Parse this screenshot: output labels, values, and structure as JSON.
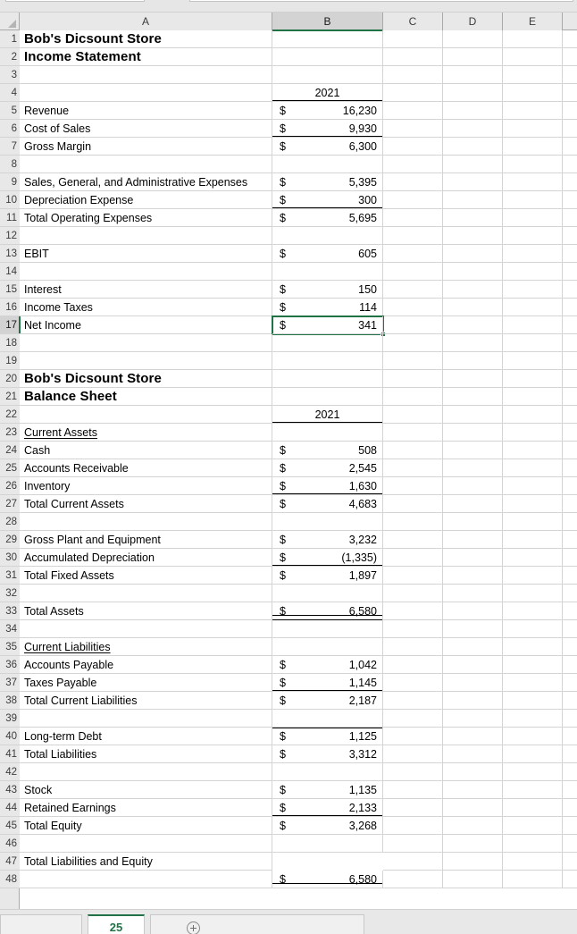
{
  "app": {
    "name": "spreadsheet",
    "selected_cell": "B17"
  },
  "columns": [
    {
      "id": "A",
      "label": "A",
      "selected": false
    },
    {
      "id": "B",
      "label": "B",
      "selected": true
    },
    {
      "id": "C",
      "label": "C",
      "selected": false
    },
    {
      "id": "D",
      "label": "D",
      "selected": false
    },
    {
      "id": "E",
      "label": "E",
      "selected": false
    }
  ],
  "row_numbers": [
    "1",
    "2",
    "3",
    "4",
    "5",
    "6",
    "7",
    "8",
    "9",
    "10",
    "11",
    "12",
    "13",
    "14",
    "15",
    "16",
    "17",
    "18",
    "19",
    "20",
    "21",
    "22",
    "23",
    "24",
    "25",
    "26",
    "27",
    "28",
    "29",
    "30",
    "31",
    "32",
    "33",
    "34",
    "35",
    "36",
    "37",
    "38",
    "39",
    "40",
    "41",
    "42",
    "43",
    "44",
    "45",
    "46",
    "47",
    "48"
  ],
  "selected_row": "17",
  "currency_symbol": "$",
  "colors": {
    "accent_green": "#217346",
    "header_gray": "#e8e8e8",
    "header_selected_gray": "#d3d3d3",
    "gridline": "#d4d4d4",
    "rule_black": "#000000"
  },
  "rows": [
    {
      "n": "1",
      "a": "Bob's Dicsount Store",
      "style": "title"
    },
    {
      "n": "2",
      "a": "Income Statement",
      "style": "title"
    },
    {
      "n": "3",
      "a": ""
    },
    {
      "n": "4",
      "a": "",
      "b": "2021",
      "b_kind": "year",
      "rule": "bottom"
    },
    {
      "n": "5",
      "a": "Revenue",
      "b": "16,230"
    },
    {
      "n": "6",
      "a": "Cost of Sales",
      "b": "9,930",
      "rule": "bottom"
    },
    {
      "n": "7",
      "a": "Gross Margin",
      "b": "6,300"
    },
    {
      "n": "8",
      "a": ""
    },
    {
      "n": "9",
      "a": "Sales, General, and Administrative Expenses",
      "b": "5,395"
    },
    {
      "n": "10",
      "a": "Depreciation Expense",
      "b": "300",
      "rule": "bottom"
    },
    {
      "n": "11",
      "a": "Total Operating Expenses",
      "b": "5,695"
    },
    {
      "n": "12",
      "a": ""
    },
    {
      "n": "13",
      "a": "EBIT",
      "b": "605"
    },
    {
      "n": "14",
      "a": ""
    },
    {
      "n": "15",
      "a": "Interest",
      "b": "150"
    },
    {
      "n": "16",
      "a": "Income Taxes",
      "b": "114"
    },
    {
      "n": "17",
      "a": "Net Income",
      "b": "341",
      "selected": true
    },
    {
      "n": "18",
      "a": ""
    },
    {
      "n": "19",
      "a": ""
    },
    {
      "n": "20",
      "a": "Bob's Dicsount Store",
      "style": "title"
    },
    {
      "n": "21",
      "a": "Balance Sheet",
      "style": "title"
    },
    {
      "n": "22",
      "a": "",
      "b": "2021",
      "b_kind": "year",
      "rule": "bottom"
    },
    {
      "n": "23",
      "a": "Current Assets",
      "style": "underline"
    },
    {
      "n": "24",
      "a": "Cash",
      "b": "508"
    },
    {
      "n": "25",
      "a": "Accounts Receivable",
      "b": "2,545"
    },
    {
      "n": "26",
      "a": "Inventory",
      "b": "1,630",
      "rule": "bottom"
    },
    {
      "n": "27",
      "a": "Total Current Assets",
      "b": "4,683"
    },
    {
      "n": "28",
      "a": ""
    },
    {
      "n": "29",
      "a": "Gross Plant and Equipment",
      "b": "3,232"
    },
    {
      "n": "30",
      "a": "Accumulated Depreciation",
      "b": "(1,335)",
      "rule": "bottom"
    },
    {
      "n": "31",
      "a": "Total Fixed Assets",
      "b": "1,897"
    },
    {
      "n": "32",
      "a": ""
    },
    {
      "n": "33",
      "a": "Total Assets",
      "b": "6,580",
      "rule": "double"
    },
    {
      "n": "34",
      "a": ""
    },
    {
      "n": "35",
      "a": "Current Liabilities",
      "style": "underline"
    },
    {
      "n": "36",
      "a": "Accounts Payable",
      "b": "1,042"
    },
    {
      "n": "37",
      "a": "Taxes Payable",
      "b": "1,145",
      "rule": "bottom"
    },
    {
      "n": "38",
      "a": "Total Current Liabilities",
      "b": "2,187"
    },
    {
      "n": "39",
      "a": ""
    },
    {
      "n": "40",
      "a": "Long-term Debt",
      "b": "1,125",
      "rule": "top"
    },
    {
      "n": "41",
      "a": "Total Liabilities",
      "b": "3,312"
    },
    {
      "n": "42",
      "a": ""
    },
    {
      "n": "43",
      "a": "Stock",
      "b": "1,135"
    },
    {
      "n": "44",
      "a": "Retained Earnings",
      "b": "2,133",
      "rule": "bottom"
    },
    {
      "n": "45",
      "a": "Total Equity",
      "b": "3,268"
    },
    {
      "n": "46",
      "a": ""
    },
    {
      "n": "47",
      "a": "Total Liabilities and Equity",
      "b": "6,580",
      "rule": "double"
    },
    {
      "n": "48",
      "a": ""
    }
  ],
  "sheet_tabs": {
    "active_tab_label": "25",
    "add_sheet_icon": "plus-circle-icon",
    "nav_arrows_icon": "sheet-nav-arrows-icon"
  }
}
